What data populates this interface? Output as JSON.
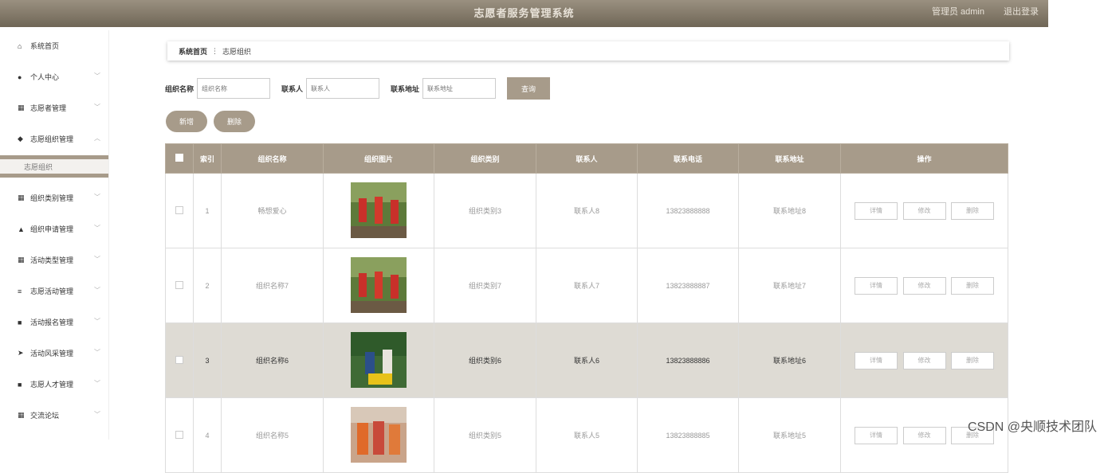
{
  "header": {
    "title": "志愿者服务管理系统",
    "user": "管理员 admin",
    "logout": "退出登录"
  },
  "sidebar": {
    "items": [
      {
        "label": "系统首页",
        "icon": "⌂",
        "arrow": ""
      },
      {
        "label": "个人中心",
        "icon": "●",
        "arrow": "﹀"
      },
      {
        "label": "志愿者管理",
        "icon": "▦",
        "arrow": "﹀"
      },
      {
        "label": "志愿组织管理",
        "icon": "◆",
        "arrow": "︿"
      },
      {
        "label": "组织类别管理",
        "icon": "▦",
        "arrow": "﹀"
      },
      {
        "label": "组织申请管理",
        "icon": "▲",
        "arrow": "﹀"
      },
      {
        "label": "活动类型管理",
        "icon": "▦",
        "arrow": "﹀"
      },
      {
        "label": "志愿活动管理",
        "icon": "≡",
        "arrow": "﹀"
      },
      {
        "label": "活动报名管理",
        "icon": "■",
        "arrow": "﹀"
      },
      {
        "label": "活动风采管理",
        "icon": "➤",
        "arrow": "﹀"
      },
      {
        "label": "志愿人才管理",
        "icon": "■",
        "arrow": "﹀"
      },
      {
        "label": "交流论坛",
        "icon": "▦",
        "arrow": "﹀"
      }
    ],
    "submenu": "志愿组织"
  },
  "breadcrumb": {
    "home": "系统首页",
    "sep": "⋮",
    "current": "志愿组织"
  },
  "search": {
    "name_label": "组织名称",
    "name_ph": "组织名称",
    "contact_label": "联系人",
    "contact_ph": "联系人",
    "addr_label": "联系地址",
    "addr_ph": "联系地址",
    "query": "查询"
  },
  "actions": {
    "add": "新增",
    "delete": "删除"
  },
  "table": {
    "headers": [
      "索引",
      "组织名称",
      "组织图片",
      "组织类别",
      "联系人",
      "联系电话",
      "联系地址",
      "操作"
    ],
    "ops": {
      "detail": "详情",
      "edit": "修改",
      "delete": "删除"
    },
    "rows": [
      {
        "index": "1",
        "name": "畅想爱心",
        "category": "组织类别3",
        "contact": "联系人8",
        "phone": "13823888888",
        "address": "联系地址8"
      },
      {
        "index": "2",
        "name": "组织名称7",
        "category": "组织类别7",
        "contact": "联系人7",
        "phone": "13823888887",
        "address": "联系地址7"
      },
      {
        "index": "3",
        "name": "组织名称6",
        "category": "组织类别6",
        "contact": "联系人6",
        "phone": "13823888886",
        "address": "联系地址6"
      },
      {
        "index": "4",
        "name": "组织名称5",
        "category": "组织类别5",
        "contact": "联系人5",
        "phone": "13823888885",
        "address": "联系地址5"
      }
    ]
  },
  "watermark": "CSDN @央顺技术团队"
}
